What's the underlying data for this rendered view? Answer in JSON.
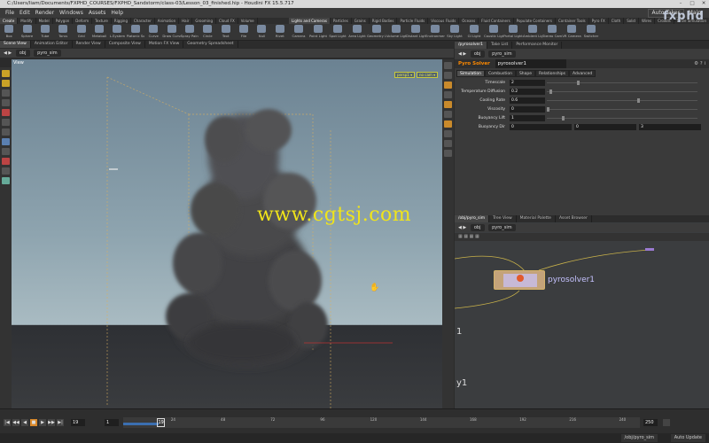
{
  "window": {
    "title": "C:/Users/liam/Documents/FXPHD_COURSES/FXPHD_Sandstorm/class-03/Lesson_03_finished.hip - Houdini FX 15.5.717"
  },
  "menu": {
    "items": [
      "File",
      "Edit",
      "Render",
      "Windows",
      "Assets",
      "Help"
    ],
    "auto_takes": "Auto Takes",
    "workspace": "Main"
  },
  "brand": "fxphd",
  "shelf": {
    "left_tabs": [
      "Create",
      "Modify",
      "Model",
      "Polygon",
      "Deform",
      "Texture",
      "Rigging",
      "Character",
      "Animation",
      "Hair",
      "Grooming",
      "Cloud FX",
      "Volume"
    ],
    "right_tabs": [
      "Lights and Cameras",
      "Particles",
      "Grains",
      "Rigid Bodies",
      "Particle Fluids",
      "Viscous Fluids",
      "Oceans",
      "Fluid Containers",
      "Populate Containers",
      "Container Tools",
      "Pyro FX",
      "Cloth",
      "Solid",
      "Wires",
      "Crowds",
      "Drive Simulation"
    ],
    "left_tools": [
      "Box",
      "Sphere",
      "Tube",
      "Torus",
      "Grid",
      "Metaball",
      "L-System",
      "Platonic Sol",
      "Curve",
      "Draw Curve",
      "Spray Paint",
      "Circle",
      "Text",
      "File",
      "Null",
      "Rivet"
    ],
    "right_tools": [
      "Camera",
      "Point Light",
      "Spot Light",
      "Area Light",
      "Geometry L",
      "Volume Light",
      "Distant Light",
      "Environment",
      "Sky Light",
      "GI Light",
      "Caustic Light",
      "Portal Light",
      "Ambient Lig",
      "Stereo Cam",
      "VR Camera",
      "Switcher"
    ]
  },
  "viewport": {
    "tabs": [
      "Scene View",
      "Animation Editor",
      "Render View",
      "Composite View",
      "Motion FX View",
      "Geometry Spreadsheet"
    ],
    "path": [
      "obj",
      "pyro_sim"
    ],
    "label": "View",
    "persp_tag": "persp1 ▾",
    "cam_tag": "no cam ▾",
    "watermark": "www.cgtsj.com"
  },
  "params_panel": {
    "tabs": [
      "/pyrosolver1",
      "Take List",
      "Performance Monitor"
    ],
    "path": [
      "obj",
      "pyro_sim"
    ],
    "node_type": "Pyro Solver",
    "node_name": "pyrosolver1",
    "subtabs": [
      "Simulation",
      "Combustion",
      "Shape",
      "Relationships",
      "Advanced"
    ],
    "params": [
      {
        "label": "Timescale",
        "value": "2",
        "slider": 0.2
      },
      {
        "label": "Temperature Diffusion",
        "value": "0.2",
        "slider": 0.02
      },
      {
        "label": "Cooling Rate",
        "value": "0.6",
        "slider": 0.6
      },
      {
        "label": "Viscosity",
        "value": "0",
        "slider": 0
      },
      {
        "label": "Buoyancy Lift",
        "value": "1",
        "slider": 0.1
      }
    ],
    "buoyancy_dir": {
      "label": "Buoyancy Dir",
      "x": "0",
      "y": "0",
      "z": "3"
    }
  },
  "network": {
    "tabs": [
      "/obj/pyro_sim",
      "Tree View",
      "Material Palette",
      "Asset Browser"
    ],
    "path": [
      "obj",
      "pyro_sim"
    ],
    "node_label": "pyrosolver1",
    "edge_labels": [
      "1",
      "y1"
    ]
  },
  "timeline": {
    "current_frame": "19",
    "start_frame": "1",
    "end_frame": "250",
    "ticks": [
      "24",
      "48",
      "72",
      "96",
      "120",
      "144",
      "168",
      "192",
      "216",
      "240"
    ],
    "cursor_frame": "19",
    "play_buttons": [
      "|◀",
      "◀◀",
      "◀",
      "■",
      "▶",
      "▶▶",
      "▶|"
    ]
  },
  "status": {
    "path": "/obj/pyro_sim",
    "auto_update": "Auto Update"
  }
}
